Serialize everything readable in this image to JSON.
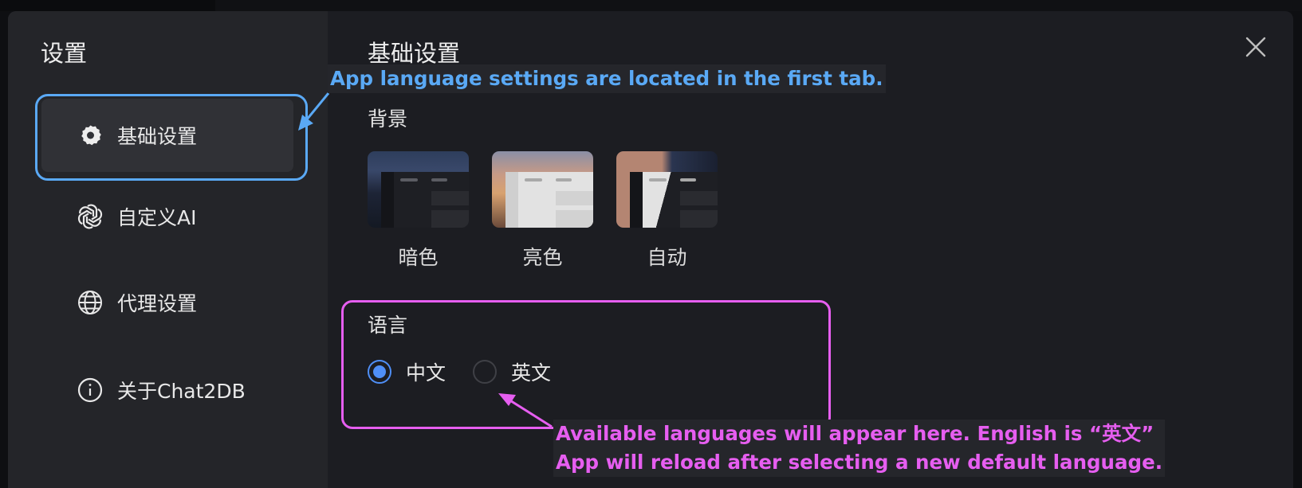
{
  "sidebar": {
    "title": "设置",
    "items": [
      {
        "label": "基础设置",
        "icon": "gear-icon",
        "active": true
      },
      {
        "label": "自定义AI",
        "icon": "openai-icon",
        "active": false
      },
      {
        "label": "代理设置",
        "icon": "globe-icon",
        "active": false
      },
      {
        "label": "关于Chat2DB",
        "icon": "info-icon",
        "active": false
      }
    ]
  },
  "main": {
    "title": "基础设置",
    "close_icon": "close-icon",
    "background": {
      "label": "背景",
      "themes": [
        {
          "label": "暗色",
          "selected": true
        },
        {
          "label": "亮色",
          "selected": false
        },
        {
          "label": "自动",
          "selected": false
        }
      ]
    },
    "language": {
      "label": "语言",
      "options": [
        {
          "label": "中文",
          "checked": true
        },
        {
          "label": "英文",
          "checked": false
        }
      ]
    }
  },
  "annotations": {
    "tab_note": "App language settings are located in the first tab.",
    "language_note_line1": "Available languages will appear here. English is “英文”",
    "language_note_line2": "App will reload after selecting a new default language."
  },
  "colors": {
    "accent": "#4f8ff7",
    "annotation_blue": "#5aa9f5",
    "annotation_pink": "#e65ef0"
  }
}
